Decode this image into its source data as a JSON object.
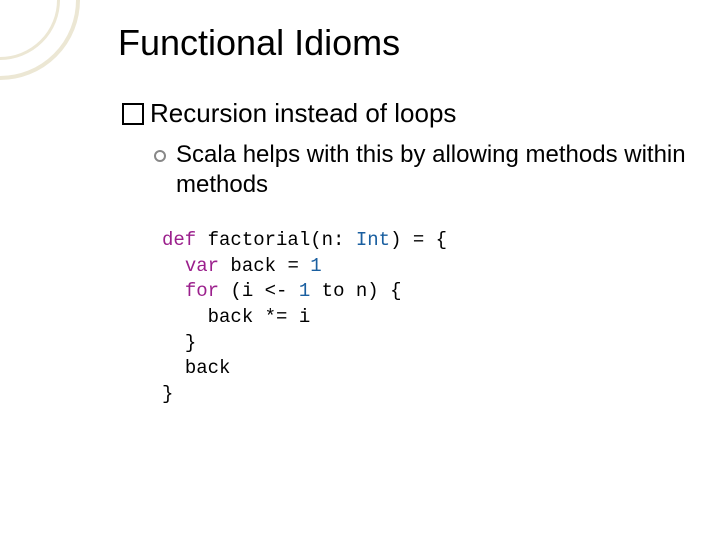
{
  "title": "Functional Idioms",
  "bullet": "Recursion instead of loops",
  "subpoint": "Scala helps with this by allowing methods within methods",
  "code": {
    "kw_def": "def",
    "fn_decl": " factorial(n: ",
    "type_int": "Int",
    "fn_decl_tail": ") = {",
    "kw_var": "var",
    "var_line": " back = ",
    "num_1a": "1",
    "kw_for": "for",
    "for_head": " (i <- ",
    "num_1b": "1",
    "for_mid": " to n) {",
    "body": "back *= i",
    "close1": "}",
    "ret": "back",
    "close2": "}"
  }
}
